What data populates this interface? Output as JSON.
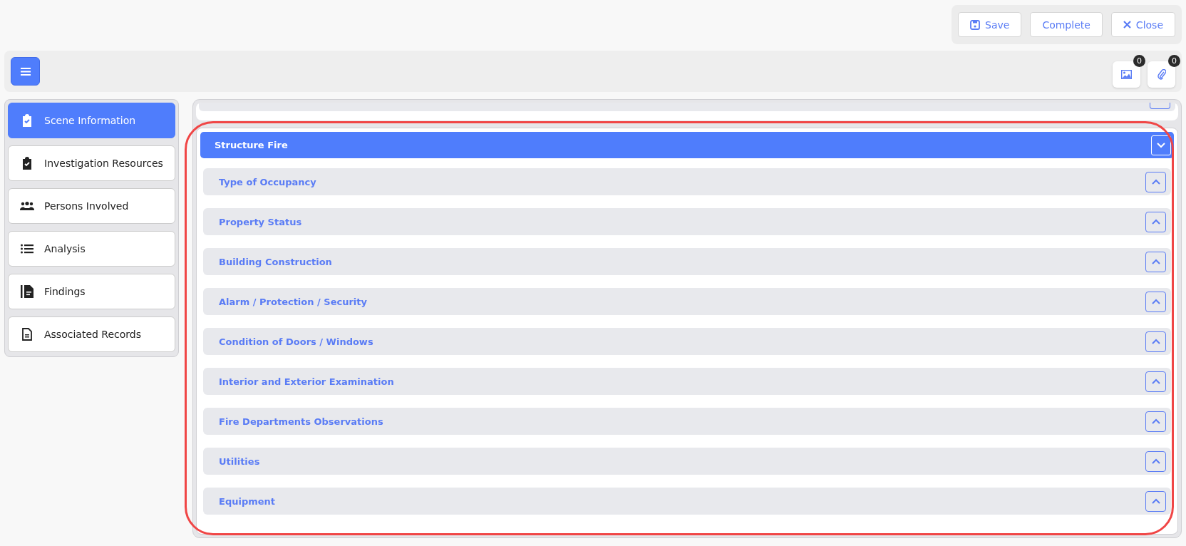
{
  "header_actions": [
    {
      "kind": "save",
      "label": "Save"
    },
    {
      "kind": "plain",
      "label": "Complete"
    },
    {
      "kind": "close",
      "label": "Close"
    }
  ],
  "toolbar": {
    "attachments": [
      {
        "kind": "image",
        "count": "0"
      },
      {
        "kind": "paperclip",
        "count": "0"
      }
    ]
  },
  "sidebar": {
    "items": [
      {
        "kind": "clipboard-check",
        "label": "Scene Information",
        "selected": true
      },
      {
        "kind": "clipboard-check",
        "label": "Investigation Resources",
        "selected": false
      },
      {
        "kind": "people",
        "label": "Persons Involved",
        "selected": false
      },
      {
        "kind": "list",
        "label": "Analysis",
        "selected": false
      },
      {
        "kind": "file-bar",
        "label": "Findings",
        "selected": false
      },
      {
        "kind": "file",
        "label": "Associated Records",
        "selected": false
      }
    ]
  },
  "section": {
    "title": "Structure Fire",
    "expanded": true,
    "subsections": [
      {
        "title": "Type of Occupancy",
        "expanded": false
      },
      {
        "title": "Property Status",
        "expanded": false
      },
      {
        "title": "Building Construction",
        "expanded": false
      },
      {
        "title": "Alarm / Protection / Security",
        "expanded": false
      },
      {
        "title": "Condition of Doors / Windows",
        "expanded": false
      },
      {
        "title": "Interior and Exterior Examination",
        "expanded": false
      },
      {
        "title": "Fire Departments Observations",
        "expanded": false
      },
      {
        "title": "Utilities",
        "expanded": false
      },
      {
        "title": "Equipment",
        "expanded": false
      }
    ]
  }
}
